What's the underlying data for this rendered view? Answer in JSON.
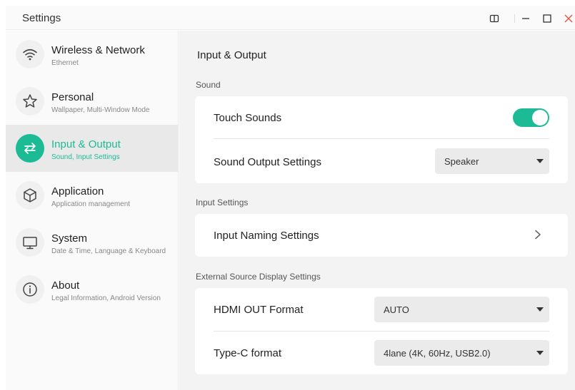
{
  "window": {
    "title": "Settings",
    "controls": [
      "split-view-icon",
      "minimize-icon",
      "maximize-icon",
      "close-icon"
    ],
    "close_color": "#e8533c"
  },
  "theme": {
    "accent": "#1cbb95"
  },
  "sidebar": {
    "items": [
      {
        "label": "Wireless & Network",
        "sub": "Ethernet",
        "icon": "wifi-icon",
        "active": false
      },
      {
        "label": "Personal",
        "sub": "Wallpaper, Multi-Window Mode",
        "icon": "star-icon",
        "active": false
      },
      {
        "label": "Input & Output",
        "sub": "Sound, Input Settings",
        "icon": "swap-arrows-icon",
        "active": true
      },
      {
        "label": "Application",
        "sub": "Application management",
        "icon": "cube-icon",
        "active": false
      },
      {
        "label": "System",
        "sub": "Date & Time, Language & Keyboard",
        "icon": "monitor-icon",
        "active": false
      },
      {
        "label": "About",
        "sub": "Legal Information, Android Version",
        "icon": "info-icon",
        "active": false
      }
    ]
  },
  "main": {
    "title": "Input & Output",
    "sound": {
      "section_label": "Sound",
      "touch_sounds_label": "Touch Sounds",
      "touch_sounds_on": true,
      "output_label": "Sound Output Settings",
      "output_value": "Speaker"
    },
    "input": {
      "section_label": "Input Settings",
      "naming_label": "Input Naming Settings"
    },
    "external": {
      "section_label": "External Source Display Settings",
      "hdmi_label": "HDMI OUT Format",
      "hdmi_value": "AUTO",
      "typec_label": "Type-C format",
      "typec_value": "4lane (4K, 60Hz, USB2.0)"
    }
  }
}
